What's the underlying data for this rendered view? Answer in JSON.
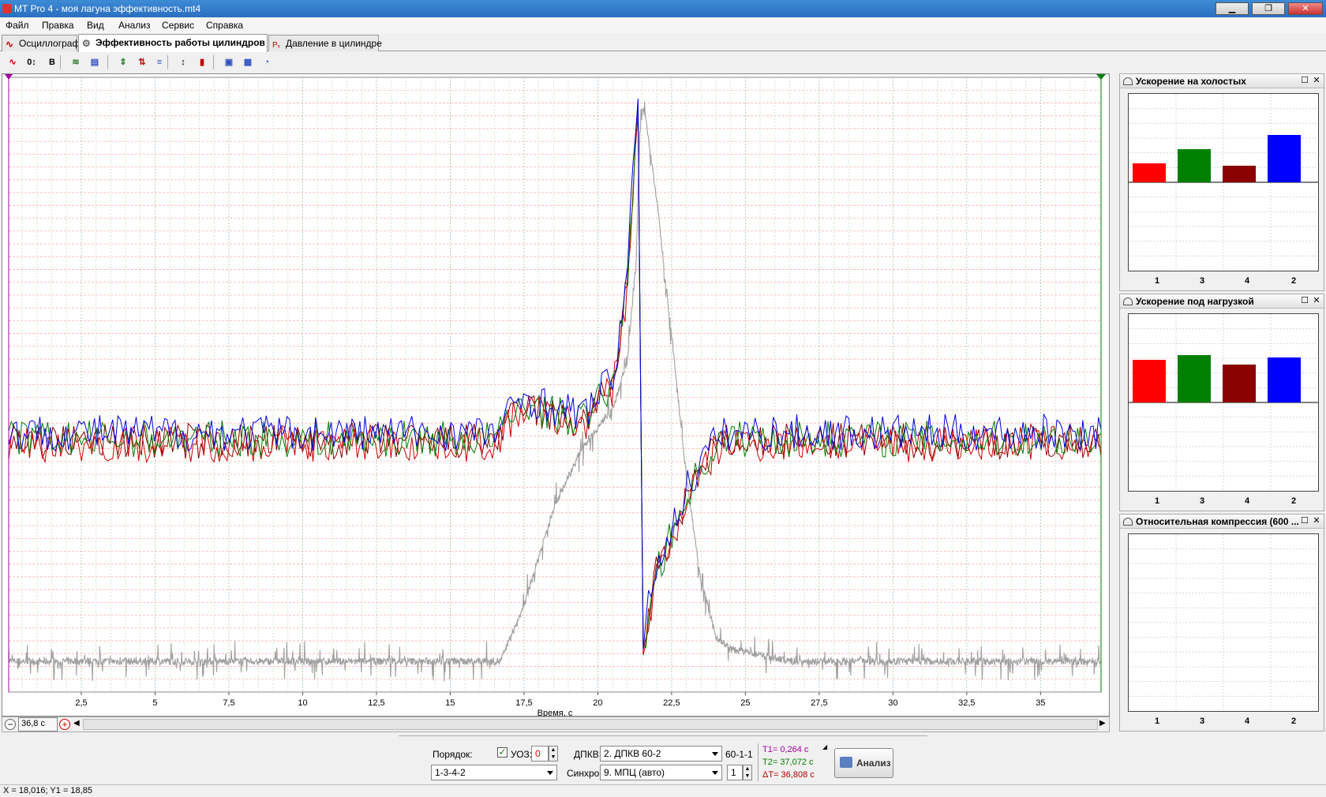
{
  "window": {
    "title": "MT Pro 4 - моя лагуна эффективность.mt4",
    "minimize": "▁",
    "restore": "❐",
    "close": "✕"
  },
  "menu": [
    "Файл",
    "Правка",
    "Вид",
    "Анализ",
    "Сервис",
    "Справка"
  ],
  "tabs": [
    {
      "label": "Осциллограф",
      "icon": "oscillograph-icon"
    },
    {
      "label": "Эффективность работы цилиндров",
      "icon": "gears-icon"
    },
    {
      "label": "Давление в цилиндре",
      "icon": "pressure-icon"
    }
  ],
  "toolbar": {
    "items": [
      {
        "name": "sine-wave-icon",
        "glyph": "∿",
        "color": "#c00000"
      },
      {
        "name": "zero-offset-icon",
        "glyph": "0↕",
        "color": "#000000"
      },
      {
        "name": "bold-b-icon",
        "glyph": "B",
        "color": "#000000"
      },
      {
        "name": "multi-wave-icon",
        "glyph": "≋",
        "color": "#2a7a2a"
      },
      {
        "name": "display-icon",
        "glyph": "▤",
        "color": "#3050c0"
      },
      {
        "name": "arrows-vertical-icon",
        "glyph": "⇕",
        "color": "#2a7a2a"
      },
      {
        "name": "arrows-sort-icon",
        "glyph": "⇅",
        "color": "#c00000"
      },
      {
        "name": "stack-icon",
        "glyph": "≡",
        "color": "#3050c0"
      },
      {
        "name": "sort-numeric-icon",
        "glyph": "↕",
        "color": "#000000"
      },
      {
        "name": "bar-chart-icon",
        "glyph": "▮",
        "color": "#c00000"
      },
      {
        "name": "copy-icon",
        "glyph": "▣",
        "color": "#3050c0"
      },
      {
        "name": "table-icon",
        "glyph": "▦",
        "color": "#3050c0"
      },
      {
        "name": "settings-icon",
        "glyph": "◔",
        "color": "#3050c0"
      }
    ]
  },
  "chart_data": {
    "type": "line",
    "xlabel": "Время, с",
    "x_ticks": [
      2.5,
      5,
      7.5,
      10,
      12.5,
      15,
      17.5,
      20,
      22.5,
      25,
      27.5,
      30,
      32.5,
      35
    ],
    "x_tick_labels": [
      "2,5",
      "5",
      "7,5",
      "10",
      "12,5",
      "15",
      "17,5",
      "20",
      "22,5",
      "25",
      "27,5",
      "30",
      "32,5",
      "35"
    ],
    "xlim": [
      0.04,
      37.05
    ],
    "ylim": [
      0,
      100
    ],
    "grid": true,
    "series_colors": [
      "#0000e0",
      "#008000",
      "#d00000",
      "#8b0000",
      "#a0a0a0"
    ],
    "profile": {
      "x": [
        0,
        16.5,
        17.5,
        18.5,
        19.5,
        20.5,
        21.0,
        21.25,
        21.4,
        21.5,
        21.7,
        22.0,
        22.5,
        23.0,
        23.5,
        24.0,
        24.5,
        37.05
      ],
      "y": [
        41,
        41,
        47,
        45,
        44,
        50,
        66,
        88,
        97,
        5,
        12,
        20,
        25,
        32,
        36,
        40,
        41,
        41
      ]
    },
    "gray_trace": {
      "x": [
        0,
        16.7,
        17.5,
        18.5,
        19.5,
        20.5,
        21.0,
        21.3,
        21.45,
        21.6,
        22.0,
        22.5,
        23.0,
        23.5,
        24.0,
        24.5,
        25.5,
        26.5,
        37.05
      ],
      "y": [
        5,
        5,
        14,
        30,
        40,
        46,
        54,
        70,
        95,
        94,
        80,
        58,
        35,
        18,
        9,
        7,
        6,
        5,
        5
      ]
    }
  },
  "chart_controls": {
    "window_length": "36,8 с"
  },
  "panels": [
    {
      "title": "Ускорение на холостых",
      "labels": [
        "1",
        "3",
        "4",
        "2"
      ],
      "values": [
        4,
        7,
        3.5,
        10
      ],
      "colors": [
        "#ff0000",
        "#008000",
        "#8b0000",
        "#0000ff"
      ]
    },
    {
      "title": "Ускорение под нагрузкой",
      "labels": [
        "1",
        "3",
        "4",
        "2"
      ],
      "values": [
        9,
        10,
        8,
        9.5
      ],
      "colors": [
        "#ff0000",
        "#008000",
        "#8b0000",
        "#0000ff"
      ]
    },
    {
      "title": "Относительная компрессия (600 ...",
      "labels": [
        "1",
        "3",
        "4",
        "2"
      ],
      "values": [],
      "colors": [
        "#ff0000",
        "#008000",
        "#8b0000",
        "#0000ff"
      ]
    }
  ],
  "bottom": {
    "order_label": "Порядок:",
    "order_value": "1-3-4-2",
    "uoz_label": "УОЗ:",
    "uoz_value": "0",
    "dpkv_label": "ДПКВ:",
    "dpkv_value": "2. ДПКВ 60-2",
    "dpkv_extra": "60-1-1",
    "sync_label": "Синхро:",
    "sync_value": "9. МПЦ (авто)",
    "sync_num": "1",
    "t1": "T1= 0,264 с",
    "t2": "T2= 37,072 с",
    "dt": "ΔT= 36,808 с",
    "analyze_label": "Анализ"
  },
  "status": {
    "text": "X = 18,016; Y1 = 18,85"
  }
}
